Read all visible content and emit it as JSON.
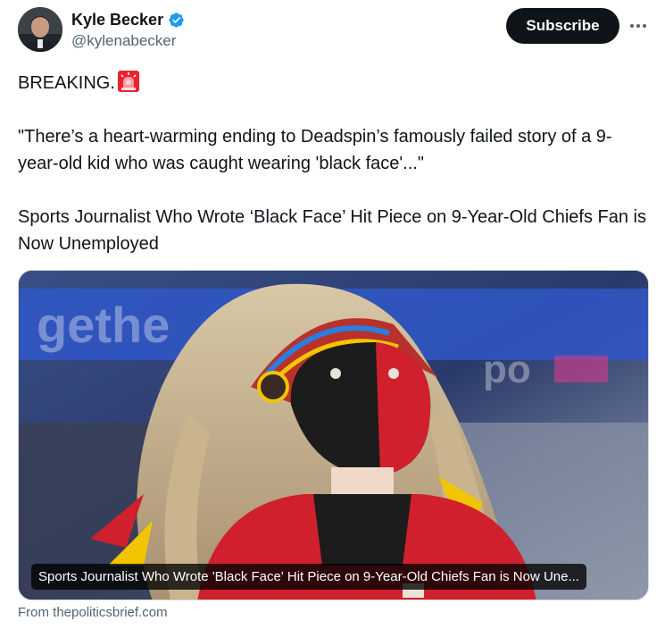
{
  "author": {
    "display_name": "Kyle Becker",
    "handle": "@kylenabecker",
    "verified_color": "#1d9bf0",
    "avatar_icon": "profile-photo"
  },
  "actions": {
    "subscribe_label": "Subscribe",
    "more_icon": "ellipsis-icon"
  },
  "tweet": {
    "line1": "BREAKING.",
    "emoji": "police-siren",
    "quote": "\"There’s a heart-warming ending to Deadspin’s famously failed story of a 9-year-old kid who was caught wearing 'black face'...\"",
    "headline": "Sports Journalist Who Wrote ‘Black Face’ Hit Piece on 9-Year-Old Chiefs Fan is Now Unemployed"
  },
  "card": {
    "caption": "Sports Journalist Who Wrote 'Black Face' Hit Piece on 9-Year-Old Chiefs Fan is Now Une...",
    "source": "From thepoliticsbrief.com"
  },
  "colors": {
    "accent": "#1d9bf0",
    "text": "#0f1419",
    "muted": "#536471",
    "chiefs_red": "#d0202d"
  }
}
